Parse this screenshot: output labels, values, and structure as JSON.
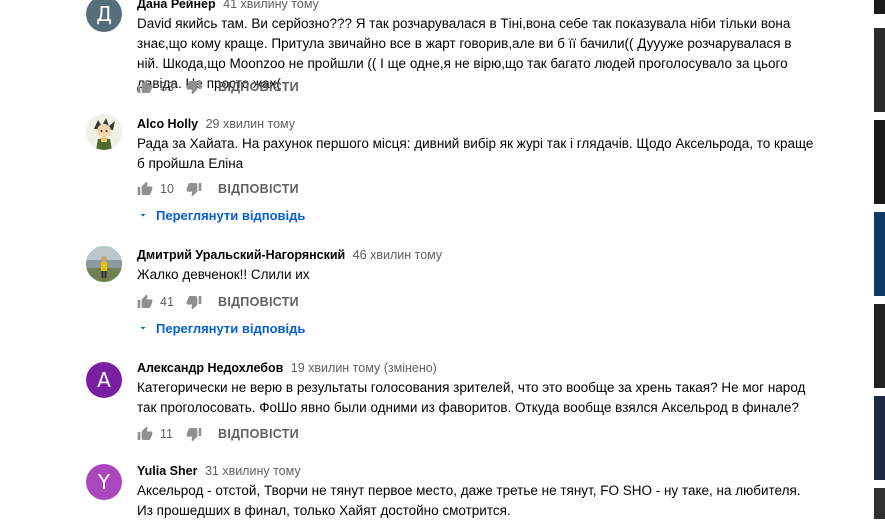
{
  "comments": [
    {
      "author": "Дана Рейнер",
      "time": "41 хвилину тому",
      "avatar_letter": "Д",
      "avatar_color": "#546e7a",
      "text": "David якийсь там. Ви серйозно??? Я так розчарувалася в Тіні,вона себе так показувала ніби тільки вона знає,що кому краще. Притула звичайно все в жарт говорив,але ви б її бачили(( Дуууже розчарувалася в ній. Шкода,що Moonzoo не пройшли (( І ще одне,я не вірю,що так багато людей проголосувало за цього давіда. Це просто жах(",
      "likes": "33",
      "reply_label": "ВІДПОВІСТИ"
    },
    {
      "author": "Alco Holly",
      "time": "29 хвилин тому",
      "text": "Рада за Хайата. На рахунок першого місця: дивний вибір як журі так і глядачів. Щодо Аксельрода, то краще б пройшла Еліна",
      "likes": "10",
      "reply_label": "ВІДПОВІСТИ",
      "view_replies": "Переглянути відповідь"
    },
    {
      "author": "Дмитрий Уральский-Нагорянский",
      "time": "46 хвилин тому",
      "text": "Жалко девченок!! Слили их",
      "likes": "41",
      "reply_label": "ВІДПОВІСТИ",
      "view_replies": "Переглянути відповідь"
    },
    {
      "author": "Александр Недохлебов",
      "time": "19 хвилин тому",
      "edited": "(змінено)",
      "avatar_letter": "A",
      "avatar_color": "#7b1fa2",
      "text": "Категорически не верю в результаты голосования зрителей, что это вообще за хрень такая? Не мог народ так проголосовать. ФоШо явно были одними из фаворитов. Откуда вообще взялся Аксельрод в финале?",
      "likes": "11",
      "reply_label": "ВІДПОВІСТИ"
    },
    {
      "author": "Yulia Sher",
      "time": "31 хвилину тому",
      "avatar_letter": "Y",
      "avatar_color": "#ab47bc",
      "text": "Аксельрод - отстой, Творчи не тянут первое место, даже третье не тянут, FO SHO - ну таке, на любителя. Из прошедших в  финал, только Хайят достойно смотрится."
    }
  ],
  "icons": {
    "like": "thumb-up-icon",
    "dislike": "thumb-down-icon",
    "expand": "chevron-down-icon"
  }
}
